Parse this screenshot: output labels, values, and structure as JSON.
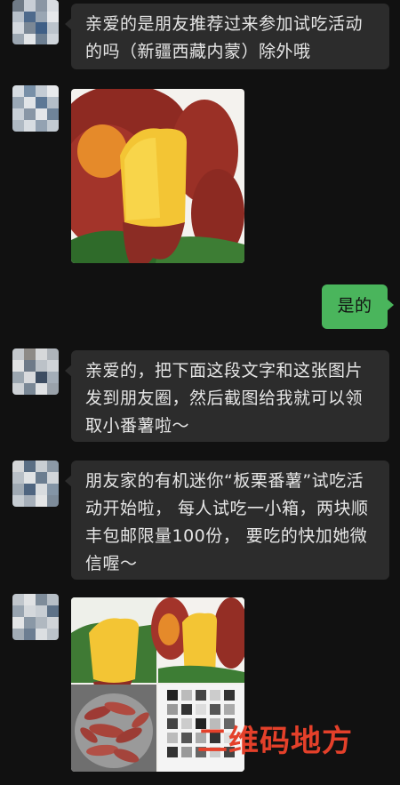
{
  "messages": [
    {
      "type": "incoming-text",
      "text": "亲爱的是朋友推荐过来参加试吃活动的吗（新疆西藏内蒙）除外哦"
    },
    {
      "type": "incoming-image",
      "description": ""
    },
    {
      "type": "outgoing-text",
      "text": "是的"
    },
    {
      "type": "incoming-text",
      "text": "亲爱的，把下面这段文字和这张图片发到朋友圈，然后截图给我就可以领取小番薯啦～"
    },
    {
      "type": "incoming-text",
      "text": "朋友家的有机迷你“板栗番薯”试吃活动开始啦， 每人试吃一小箱，两块顺丰包邮限量100份， 要吃的快加她微信喔～"
    },
    {
      "type": "incoming-image",
      "description": ""
    }
  ],
  "watermark": {
    "text": "二维码地方"
  },
  "colors": {
    "background": "#111111",
    "incoming_bubble": "#2c2c2c",
    "outgoing_bubble": "#4ab55c",
    "watermark": "#e4402a"
  }
}
